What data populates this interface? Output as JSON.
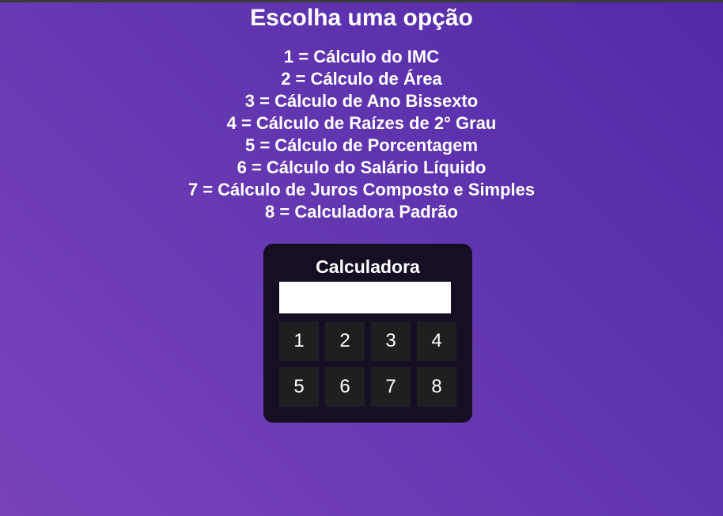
{
  "page": {
    "title": "Escolha uma opção"
  },
  "options": [
    "1 = Cálculo do IMC",
    "2 = Cálculo de Área",
    "3 = Cálculo de Ano Bissexto",
    "4 = Cálculo de Raízes de 2° Grau",
    "5 = Cálculo de Porcentagem",
    "6 = Cálculo do Salário Líquido",
    "7 = Cálculo de Juros Composto e Simples",
    "8 = Calculadora Padrão"
  ],
  "calculator": {
    "title": "Calculadora",
    "display_value": "",
    "keys": [
      "1",
      "2",
      "3",
      "4",
      "5",
      "6",
      "7",
      "8"
    ]
  },
  "colors": {
    "background_start": "#7843b9",
    "background_end": "#5329a8",
    "panel": "#160e22",
    "key": "#1f1f1f",
    "text": "#ffffff"
  }
}
